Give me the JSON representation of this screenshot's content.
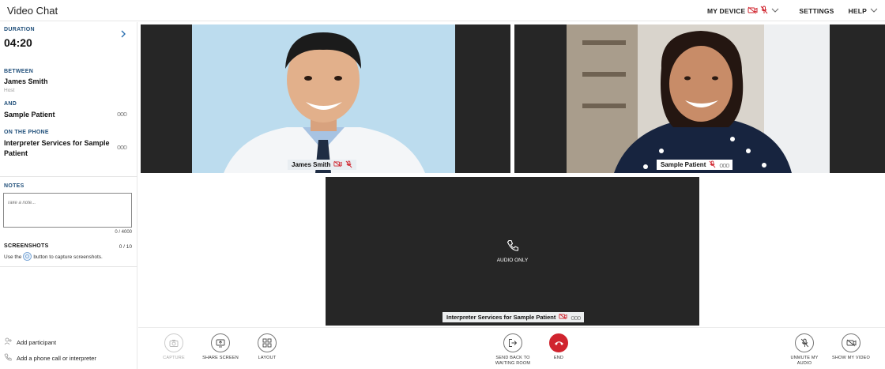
{
  "app": {
    "title": "Video Chat"
  },
  "header": {
    "my_device": "MY DEVICE",
    "settings": "SETTINGS",
    "help": "HELP"
  },
  "sidebar": {
    "duration_label": "DURATION",
    "duration_value": "04:20",
    "between_label": "BETWEEN",
    "host_name": "James Smith",
    "host_role": "Host",
    "and_label": "AND",
    "patient_name": "Sample Patient",
    "phone_label": "ON THE PHONE",
    "phone_name": "Interpreter Services for Sample Patient",
    "more": "ooo",
    "notes_label": "NOTES",
    "notes_placeholder": "Take a note...",
    "notes_count": "0 / 4000",
    "screenshots_label": "SCREENSHOTS",
    "screenshots_count": "0 / 10",
    "screenshots_help_pre": "Use the",
    "screenshots_help_post": "button to capture screenshots.",
    "add_participant": "Add participant",
    "add_phone": "Add a phone call or interpreter"
  },
  "tiles": {
    "host": {
      "name": "James Smith"
    },
    "patient": {
      "name": "Sample Patient",
      "more": "ooo"
    },
    "phone": {
      "status": "AUDIO ONLY",
      "name": "Interpreter Services for Sample Patient",
      "more": "ooo"
    }
  },
  "toolbar": {
    "capture": "CAPTURE",
    "share_screen": "SHARE SCREEN",
    "layout": "LAYOUT",
    "send_back_1": "SEND BACK TO",
    "send_back_2": "WAITING ROOM",
    "end": "END",
    "unmute_1": "UNMUTE MY",
    "unmute_2": "AUDIO",
    "show_video": "SHOW MY VIDEO"
  },
  "colors": {
    "accent": "#1f4e79",
    "danger": "#d0242e",
    "tile_bg": "#262626"
  }
}
